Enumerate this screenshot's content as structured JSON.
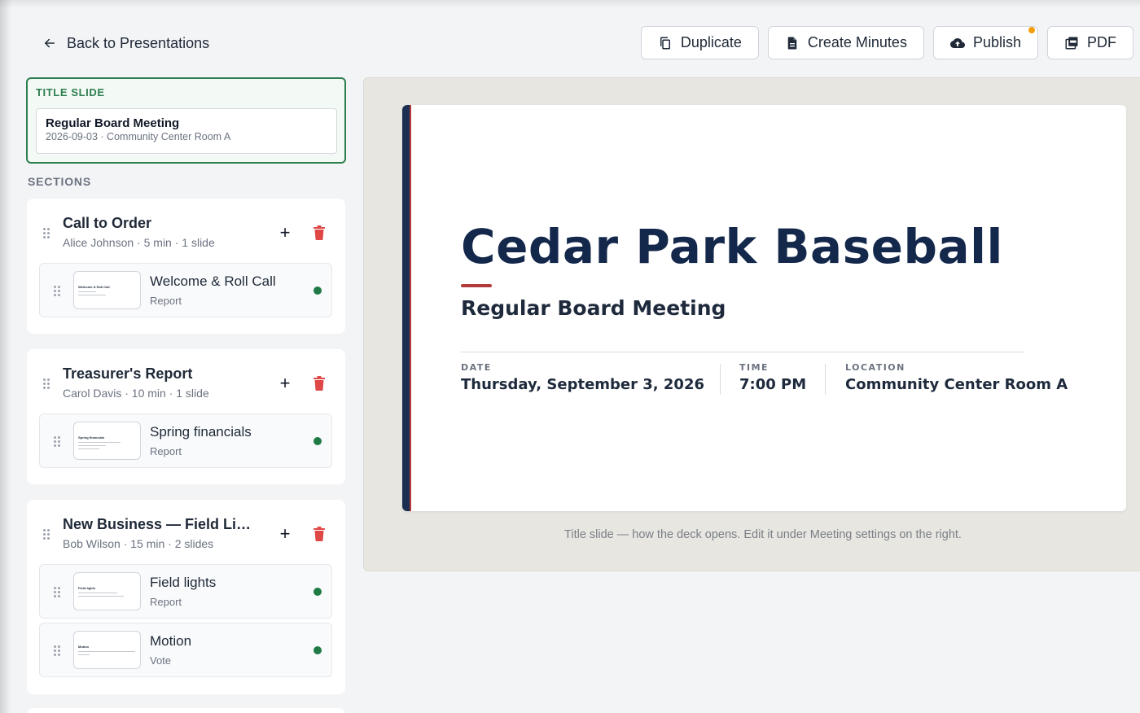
{
  "header": {
    "back_label": "Back to Presentations",
    "toolbar": {
      "duplicate": "Duplicate",
      "create_minutes": "Create Minutes",
      "publish": "Publish",
      "pdf": "PDF"
    }
  },
  "sidebar": {
    "title_slide": {
      "label": "TITLE SLIDE",
      "title": "Regular Board Meeting",
      "subtitle": "2026-09-03 · Community Center Room A"
    },
    "sections_label": "SECTIONS",
    "sections": [
      {
        "title": "Call to Order",
        "meta": "Alice Johnson · 5 min · 1 slide",
        "slides": [
          {
            "title": "Welcome & Roll Call",
            "type": "Report",
            "thumb_title": "Welcome & Roll Call"
          }
        ]
      },
      {
        "title": "Treasurer's Report",
        "meta": "Carol Davis · 10 min · 1 slide",
        "slides": [
          {
            "title": "Spring financials",
            "type": "Report",
            "thumb_title": "Spring financials"
          }
        ]
      },
      {
        "title": "New Business — Field Lights",
        "meta": "Bob Wilson · 15 min · 2 slides",
        "slides": [
          {
            "title": "Field lights",
            "type": "Report",
            "thumb_title": "Field lights"
          },
          {
            "title": "Motion",
            "type": "Vote",
            "thumb_title": "Motion"
          }
        ]
      }
    ]
  },
  "preview": {
    "heading": "Cedar Park Baseball",
    "subheading": "Regular Board Meeting",
    "date_label": "DATE",
    "date_value": "Thursday, September 3, 2026",
    "time_label": "TIME",
    "time_value": "7:00 PM",
    "location_label": "LOCATION",
    "location_value": "Community Center Room A",
    "caption": "Title slide — how the deck opens. Edit it under Meeting settings on the right."
  },
  "colors": {
    "accent_green": "#2e7d4f",
    "status_green": "#1f7a45",
    "delete_red": "#e04848",
    "slide_navy": "#14284b",
    "slide_red": "#b23a3a",
    "notify_amber": "#f59e0b"
  }
}
